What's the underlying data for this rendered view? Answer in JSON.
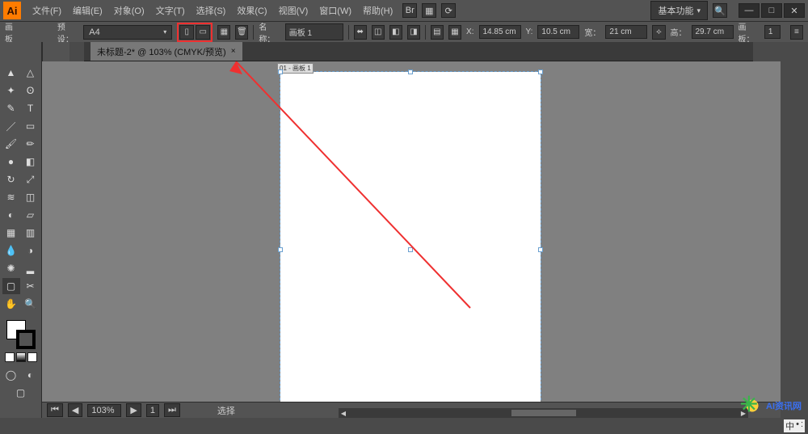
{
  "app": {
    "logo": "Ai"
  },
  "menu": {
    "file": "文件(F)",
    "edit": "编辑(E)",
    "object": "对象(O)",
    "type": "文字(T)",
    "select": "选择(S)",
    "effect": "效果(C)",
    "view": "视图(V)",
    "window": "窗口(W)",
    "help": "帮助(H)"
  },
  "workspace": {
    "label": "基本功能"
  },
  "win": {
    "min": "—",
    "max": "□",
    "close": "✕"
  },
  "control": {
    "artboard_label": "画板",
    "preset_label": "预设：",
    "preset_value": "A4",
    "name_label": "名称：",
    "name_value": "画板 1",
    "x_label": "X:",
    "x_value": "14.85 cm",
    "y_label": "Y:",
    "y_value": "10.5 cm",
    "w_label": "宽：",
    "w_value": "21 cm",
    "h_label": "高：",
    "h_value": "29.7 cm",
    "artboards_label": "画板：",
    "artboards_value": "1"
  },
  "tab": {
    "title": "未标题-2* @ 103% (CMYK/预览)",
    "close": "×"
  },
  "artboard": {
    "label": "01 - 画板 1"
  },
  "status": {
    "zoom": "103%",
    "artboard_nav": "1",
    "hint": "选择"
  },
  "watermark": "AI资讯网",
  "ime": {
    "a": "中",
    "b": "•",
    "c": ":"
  }
}
